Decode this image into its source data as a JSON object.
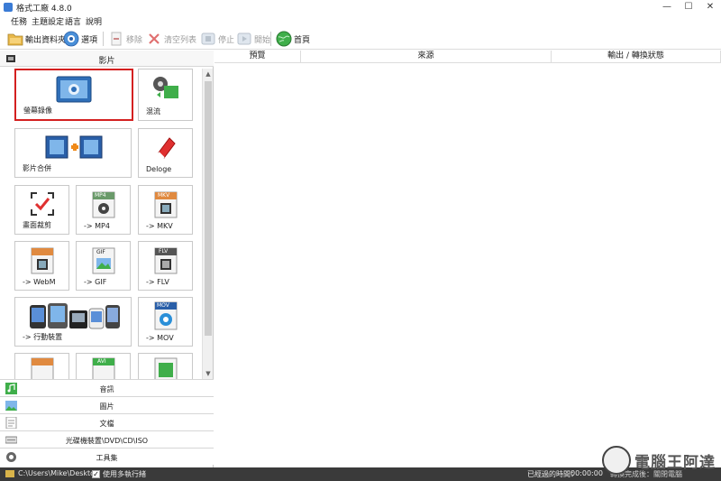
{
  "window": {
    "title": "格式工廠 4.8.0",
    "minimize": "—",
    "maximize": "☐",
    "close": "✕"
  },
  "menu": [
    "任務",
    "主題設定",
    "語言",
    "說明"
  ],
  "toolbar": {
    "output_folder": "輸出資料夾",
    "options": "選項",
    "remove": "移除",
    "clear_list": "清空列表",
    "stop": "停止",
    "start": "開始",
    "homepage": "首頁"
  },
  "categories": {
    "video": "影片",
    "audio": "音訊",
    "image": "圖片",
    "document": "文檔",
    "rom": "光碟機裝置\\DVD\\CD\\ISO",
    "tools": "工具集"
  },
  "tiles": {
    "screen_record": "螢幕錄像",
    "remux": "混流",
    "video_join": "影片合併",
    "deloge": "Deloge",
    "crop": "畫面裁剪",
    "mp4": "-> MP4",
    "mkv": "-> MKV",
    "webm": "-> WebM",
    "gif": "-> GIF",
    "flv": "-> FLV",
    "mobile": "-> 行動裝置",
    "mov": "-> MOV"
  },
  "tile_badges": {
    "mp4": "MP4",
    "mkv": "MKV",
    "gif": "GIF",
    "flv": "FLV",
    "mov": "MOV",
    "avi": "AVI"
  },
  "table": {
    "columns": [
      "預覽",
      "來源",
      "輸出 / 轉換狀態"
    ]
  },
  "status": {
    "path": "C:\\Users\\Mike\\Desktop",
    "multithread_checked": "✓",
    "multithread": "使用多執行緒",
    "elapsed_label": "已經過的時間：",
    "elapsed_time": "00:00:00",
    "after_complete": "轉換完成後：關閉電腦"
  },
  "watermark": "電腦王阿達",
  "colors": {
    "accent": "#d42020",
    "statusbar": "#3a3a3a",
    "brand_blue": "#3a7bd5"
  }
}
